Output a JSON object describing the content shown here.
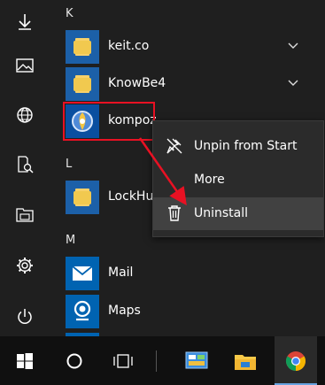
{
  "start_menu": {
    "groups": [
      {
        "header": "K",
        "apps": [
          {
            "label": "keit.co",
            "icon": "folder-icon",
            "expandable": true
          },
          {
            "label": "KnowBe4",
            "icon": "folder-icon",
            "expandable": true
          },
          {
            "label": "kompoz",
            "icon": "kompoz-app-icon",
            "expandable": false,
            "highlighted": true
          }
        ]
      },
      {
        "header": "L",
        "apps": [
          {
            "label": "LockHun",
            "icon": "folder-icon",
            "expandable": false
          }
        ]
      },
      {
        "header": "M",
        "apps": [
          {
            "label": "Mail",
            "icon": "mail-icon",
            "expandable": false
          },
          {
            "label": "Maps",
            "icon": "maps-icon",
            "expandable": false
          }
        ]
      }
    ]
  },
  "context_menu": {
    "items": [
      {
        "label": "Unpin from Start",
        "icon": "unpin-icon"
      },
      {
        "label": "More",
        "icon": ""
      },
      {
        "label": "Uninstall",
        "icon": "trash-icon",
        "highlighted": true
      }
    ]
  },
  "left_rail": [
    "down-arrow-icon",
    "pictures-icon",
    "globe-icon",
    "document-search-icon",
    "file-explorer-icon",
    "settings-icon",
    "power-icon"
  ],
  "taskbar": [
    "windows-start-icon",
    "cortana-icon",
    "task-view-icon",
    "control-panel-icon",
    "file-explorer-icon",
    "chrome-icon"
  ],
  "colors": {
    "accent": "#0063b1",
    "highlight_box": "#e81123",
    "arrow": "#e81123",
    "menu_bg": "#2b2b2b"
  }
}
